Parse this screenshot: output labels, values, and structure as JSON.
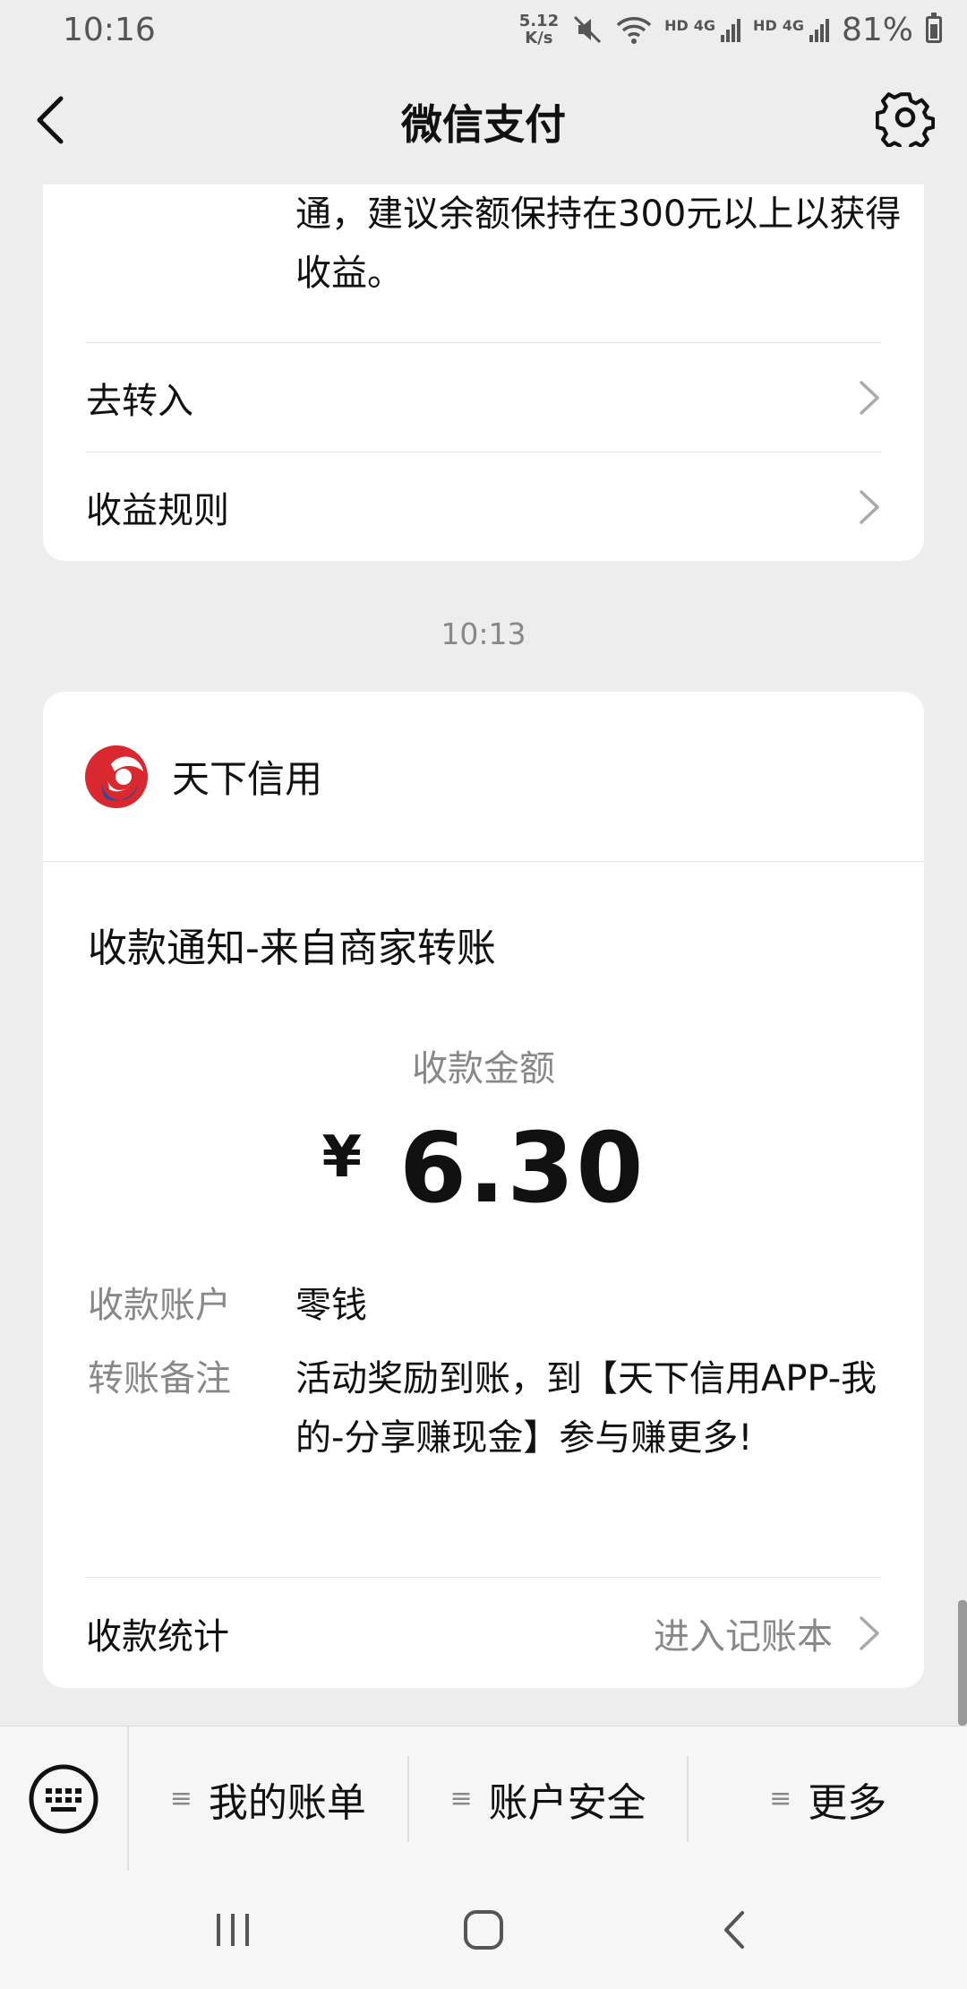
{
  "status_bar": {
    "time": "10:16",
    "net_speed_value": "5.12",
    "net_speed_unit": "K/s",
    "sim1_label": "HD",
    "sim2_label": "HD",
    "network": "4G",
    "battery": "81%"
  },
  "header": {
    "title": "微信支付"
  },
  "top_card": {
    "description": "通，建议余额保持在300元以上以获得收益。",
    "rows": [
      {
        "label": "去转入"
      },
      {
        "label": "收益规则"
      }
    ]
  },
  "message_time": "10:13",
  "notice_card": {
    "merchant_name": "天下信用",
    "title": "收款通知-来自商家转账",
    "amount_label": "收款金额",
    "currency_symbol": "¥",
    "amount": "6.30",
    "fields": [
      {
        "key": "收款账户",
        "value": "零钱"
      },
      {
        "key": "转账备注",
        "value": "活动奖励到账，到【天下信用APP-我的-分享赚现金】参与赚更多!"
      }
    ],
    "stats_label": "收款统计",
    "stats_link": "进入记账本"
  },
  "bottom_menu": {
    "items": [
      {
        "label": "我的账单"
      },
      {
        "label": "账户安全"
      },
      {
        "label": "更多"
      }
    ]
  },
  "icons": {
    "back": "back-arrow-icon",
    "settings": "gear-icon",
    "chevron": "chevron-right-icon",
    "keyboard": "keyboard-icon",
    "menu": "menu-lines-icon",
    "merchant_logo": "tianxia-credit-logo"
  },
  "colors": {
    "background": "#ededed",
    "card": "#ffffff",
    "muted_text": "#888888",
    "logo_red": "#d9282f",
    "logo_blue": "#1f4ea3"
  }
}
